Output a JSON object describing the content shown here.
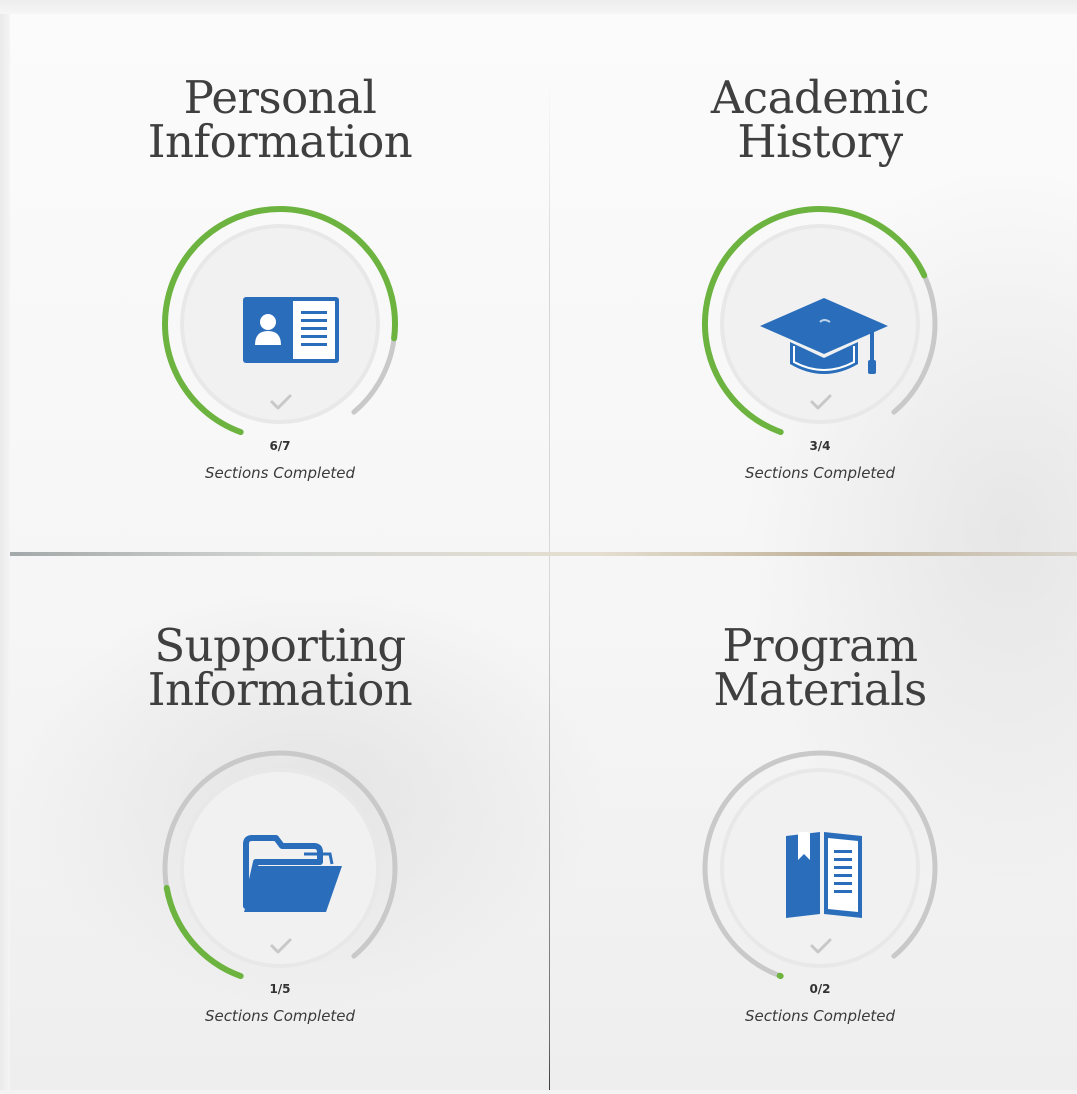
{
  "cards": [
    {
      "title_line1": "Personal",
      "title_line2": "Information",
      "count": "6/7",
      "completed": 6,
      "total": 7,
      "status": "Sections Completed",
      "icon": "id-card-icon"
    },
    {
      "title_line1": "Academic",
      "title_line2": "History",
      "count": "3/4",
      "completed": 3,
      "total": 4,
      "status": "Sections Completed",
      "icon": "graduation-cap-icon"
    },
    {
      "title_line1": "Supporting",
      "title_line2": "Information",
      "count": "1/5",
      "completed": 1,
      "total": 5,
      "status": "Sections Completed",
      "icon": "folder-icon"
    },
    {
      "title_line1": "Program",
      "title_line2": "Materials",
      "count": "0/2",
      "completed": 0,
      "total": 2,
      "status": "Sections Completed",
      "icon": "book-icon"
    }
  ],
  "colors": {
    "progress": "#6cb33f",
    "track": "#c9c9c9",
    "icon": "#2a6ebb",
    "check": "#c8c8c8"
  }
}
